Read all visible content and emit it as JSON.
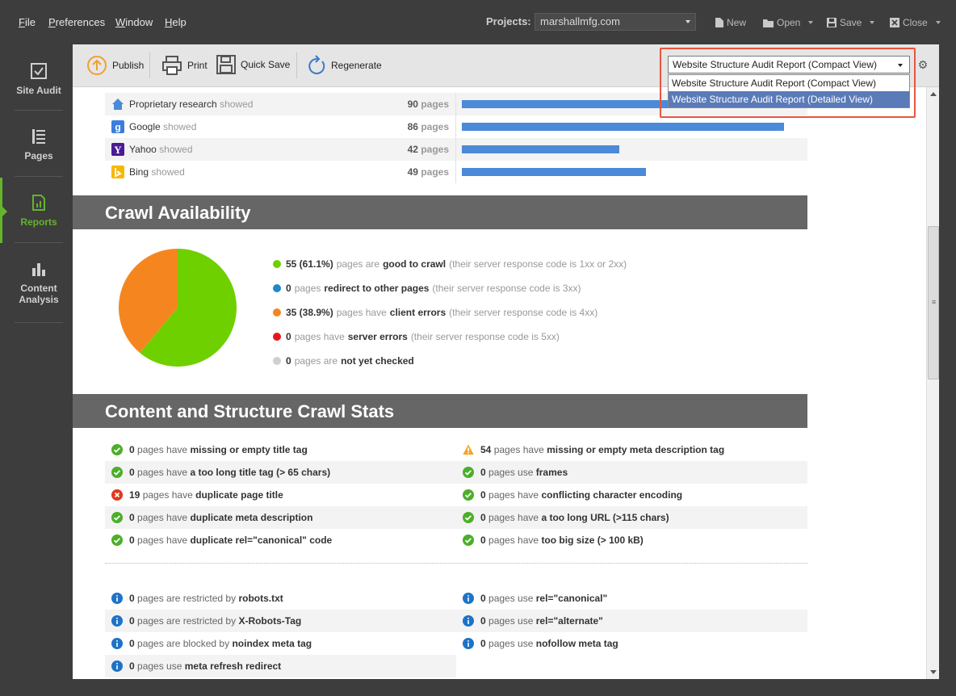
{
  "menu": {
    "items": [
      {
        "label": "File",
        "accel": "F",
        "rest": "ile"
      },
      {
        "label": "Preferences",
        "accel": "P",
        "rest": "references"
      },
      {
        "label": "Window",
        "accel": "W",
        "rest": "indow"
      },
      {
        "label": "Help",
        "accel": "H",
        "rest": "elp"
      }
    ],
    "projects_label": "Projects:",
    "project_value": "marshallmfg.com",
    "buttons": {
      "new": "New",
      "open": "Open",
      "save": "Save",
      "close": "Close"
    }
  },
  "sidebar": {
    "items": [
      {
        "label": "Site Audit",
        "active": false
      },
      {
        "label": "Pages",
        "active": false
      },
      {
        "label": "Reports",
        "active": true
      },
      {
        "label": "Content Analysis",
        "active": false
      }
    ],
    "active_color": "#66b32e"
  },
  "toolbar": {
    "publish": "Publish",
    "print": "Print",
    "quick_save": "Quick Save",
    "regenerate": "Regenerate",
    "report_select": "Website Structure Audit Report (Compact View)",
    "report_options": [
      "Website Structure Audit Report (Compact View)",
      "Website Structure Audit Report (Detailed View)"
    ],
    "selected_option_index": 1
  },
  "rankings": {
    "bar_color": "#4a8ad8",
    "max_pages": 90,
    "rows": [
      {
        "name": "Proprietary research",
        "suffix": "showed",
        "count": "90",
        "unit": "pages",
        "value": 90,
        "icon": "home-icon"
      },
      {
        "name": "Google",
        "suffix": "showed",
        "count": "86",
        "unit": "pages",
        "value": 86,
        "icon": "google-icon"
      },
      {
        "name": "Yahoo",
        "suffix": "showed",
        "count": "42",
        "unit": "pages",
        "value": 42,
        "icon": "yahoo-icon"
      },
      {
        "name": "Bing",
        "suffix": "showed",
        "count": "49",
        "unit": "pages",
        "value": 49,
        "icon": "bing-icon"
      }
    ]
  },
  "crawl": {
    "title": "Crawl Availability",
    "pie": [
      {
        "label": "good to crawl",
        "value": 55,
        "color": "#6fd000"
      },
      {
        "label": "client errors",
        "value": 35,
        "color": "#f5861f"
      }
    ],
    "legend": [
      {
        "color": "#6fd000",
        "lead": "55 (61.1%)",
        "mid": "pages are",
        "strong": "good to crawl",
        "note": "(their server response code is 1xx or 2xx)"
      },
      {
        "color": "#1e88c8",
        "lead": "0",
        "mid": "pages",
        "strong": "redirect to other pages",
        "note": "(their server response code is 3xx)"
      },
      {
        "color": "#f5861f",
        "lead": "35 (38.9%)",
        "mid": "pages have",
        "strong": "client errors",
        "note": "(their server response code is 4xx)"
      },
      {
        "color": "#e8161c",
        "lead": "0",
        "mid": "pages have",
        "strong": "server errors",
        "note": "(their server response code is 5xx)"
      },
      {
        "color": "#cfcfcf",
        "lead": "0",
        "mid": "pages are",
        "strong": "not yet checked",
        "note": ""
      }
    ]
  },
  "stats": {
    "title": "Content and Structure Crawl Stats",
    "left": [
      {
        "icon": "check-icon",
        "n": "0",
        "mid": "pages have",
        "strong": "missing or empty title tag"
      },
      {
        "icon": "check-icon",
        "n": "0",
        "mid": "pages have",
        "strong": "a too long title tag (> 65 chars)"
      },
      {
        "icon": "error-icon",
        "n": "19",
        "mid": "pages have",
        "strong": "duplicate page title"
      },
      {
        "icon": "check-icon",
        "n": "0",
        "mid": "pages have",
        "strong": "duplicate meta description"
      },
      {
        "icon": "check-icon",
        "n": "0",
        "mid": "pages have",
        "strong": "duplicate rel=\"canonical\" code"
      }
    ],
    "right": [
      {
        "icon": "warning-icon",
        "n": "54",
        "mid": "pages have",
        "strong": "missing or empty meta description tag"
      },
      {
        "icon": "check-icon",
        "n": "0",
        "mid": "pages use",
        "strong": "frames"
      },
      {
        "icon": "check-icon",
        "n": "0",
        "mid": "pages have",
        "strong": "conflicting character encoding"
      },
      {
        "icon": "check-icon",
        "n": "0",
        "mid": "pages have",
        "strong": "a too long URL (>115 chars)"
      },
      {
        "icon": "check-icon",
        "n": "0",
        "mid": "pages have",
        "strong": "too big size (> 100 kB)"
      }
    ],
    "info_left": [
      {
        "icon": "info-icon",
        "n": "0",
        "mid": "pages are restricted by",
        "strong": "robots.txt"
      },
      {
        "icon": "info-icon",
        "n": "0",
        "mid": "pages are restricted by",
        "strong": "X-Robots-Tag"
      },
      {
        "icon": "info-icon",
        "n": "0",
        "mid": "pages are blocked by",
        "strong": "noindex meta tag"
      },
      {
        "icon": "info-icon",
        "n": "0",
        "mid": "pages use",
        "strong": "meta refresh redirect"
      }
    ],
    "info_right": [
      {
        "icon": "info-icon",
        "n": "0",
        "mid": "pages use",
        "strong": "rel=\"canonical\""
      },
      {
        "icon": "info-icon",
        "n": "0",
        "mid": "pages use",
        "strong": "rel=\"alternate\""
      },
      {
        "icon": "info-icon",
        "n": "0",
        "mid": "pages use",
        "strong": "nofollow meta tag"
      }
    ]
  }
}
